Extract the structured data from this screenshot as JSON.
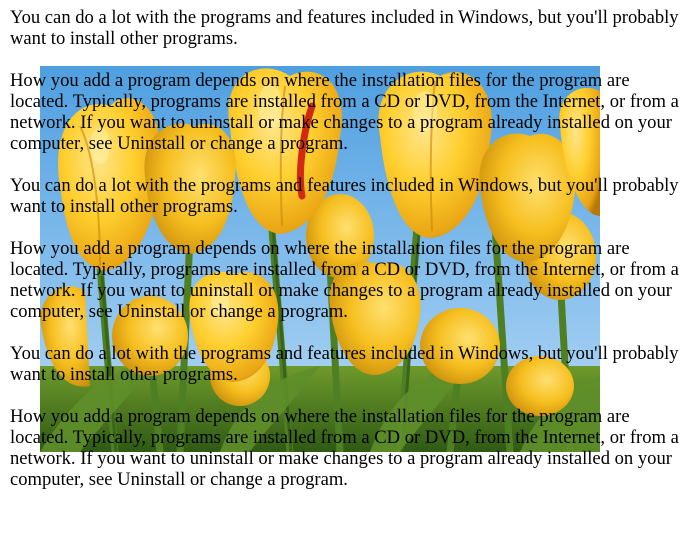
{
  "paragraphs": [
    "You can do a lot with the programs and features included in Windows, but you'll probably want to install other programs.",
    "How you add a program depends on where the installation files for the program are located. Typically, programs are installed from a CD or DVD, from the Internet, or from a network. If you want to uninstall or make changes to a program already installed on your computer, see Uninstall or change a program.",
    "You can do a lot with the programs and features included in Windows, but you'll probably want to install other programs.",
    "How you add a program depends on where the installation files for the program are located. Typically, programs are installed from a CD or DVD, from the Internet, or from a network. If you want to uninstall or make changes to a program already installed on your computer, see Uninstall or change a program.",
    "You can do a lot with the programs and features included in Windows, but you'll probably want to install other programs.",
    "How you add a program depends on where the installation files for the program are located. Typically, programs are installed from a CD or DVD, from the Internet, or from a network. If you want to uninstall or make changes to a program already installed on your computer, see Uninstall or change a program."
  ],
  "image": {
    "subject": "tulips-photo",
    "colors": {
      "sky_top": "#4f9fe0",
      "sky_bottom": "#bcdcf4",
      "petal_light": "#ffd84a",
      "petal_mid": "#f2b41c",
      "petal_dark": "#c8860a",
      "stem": "#4f7f23",
      "stem_dark": "#2f5a14",
      "accent_red": "#d22a12"
    }
  }
}
